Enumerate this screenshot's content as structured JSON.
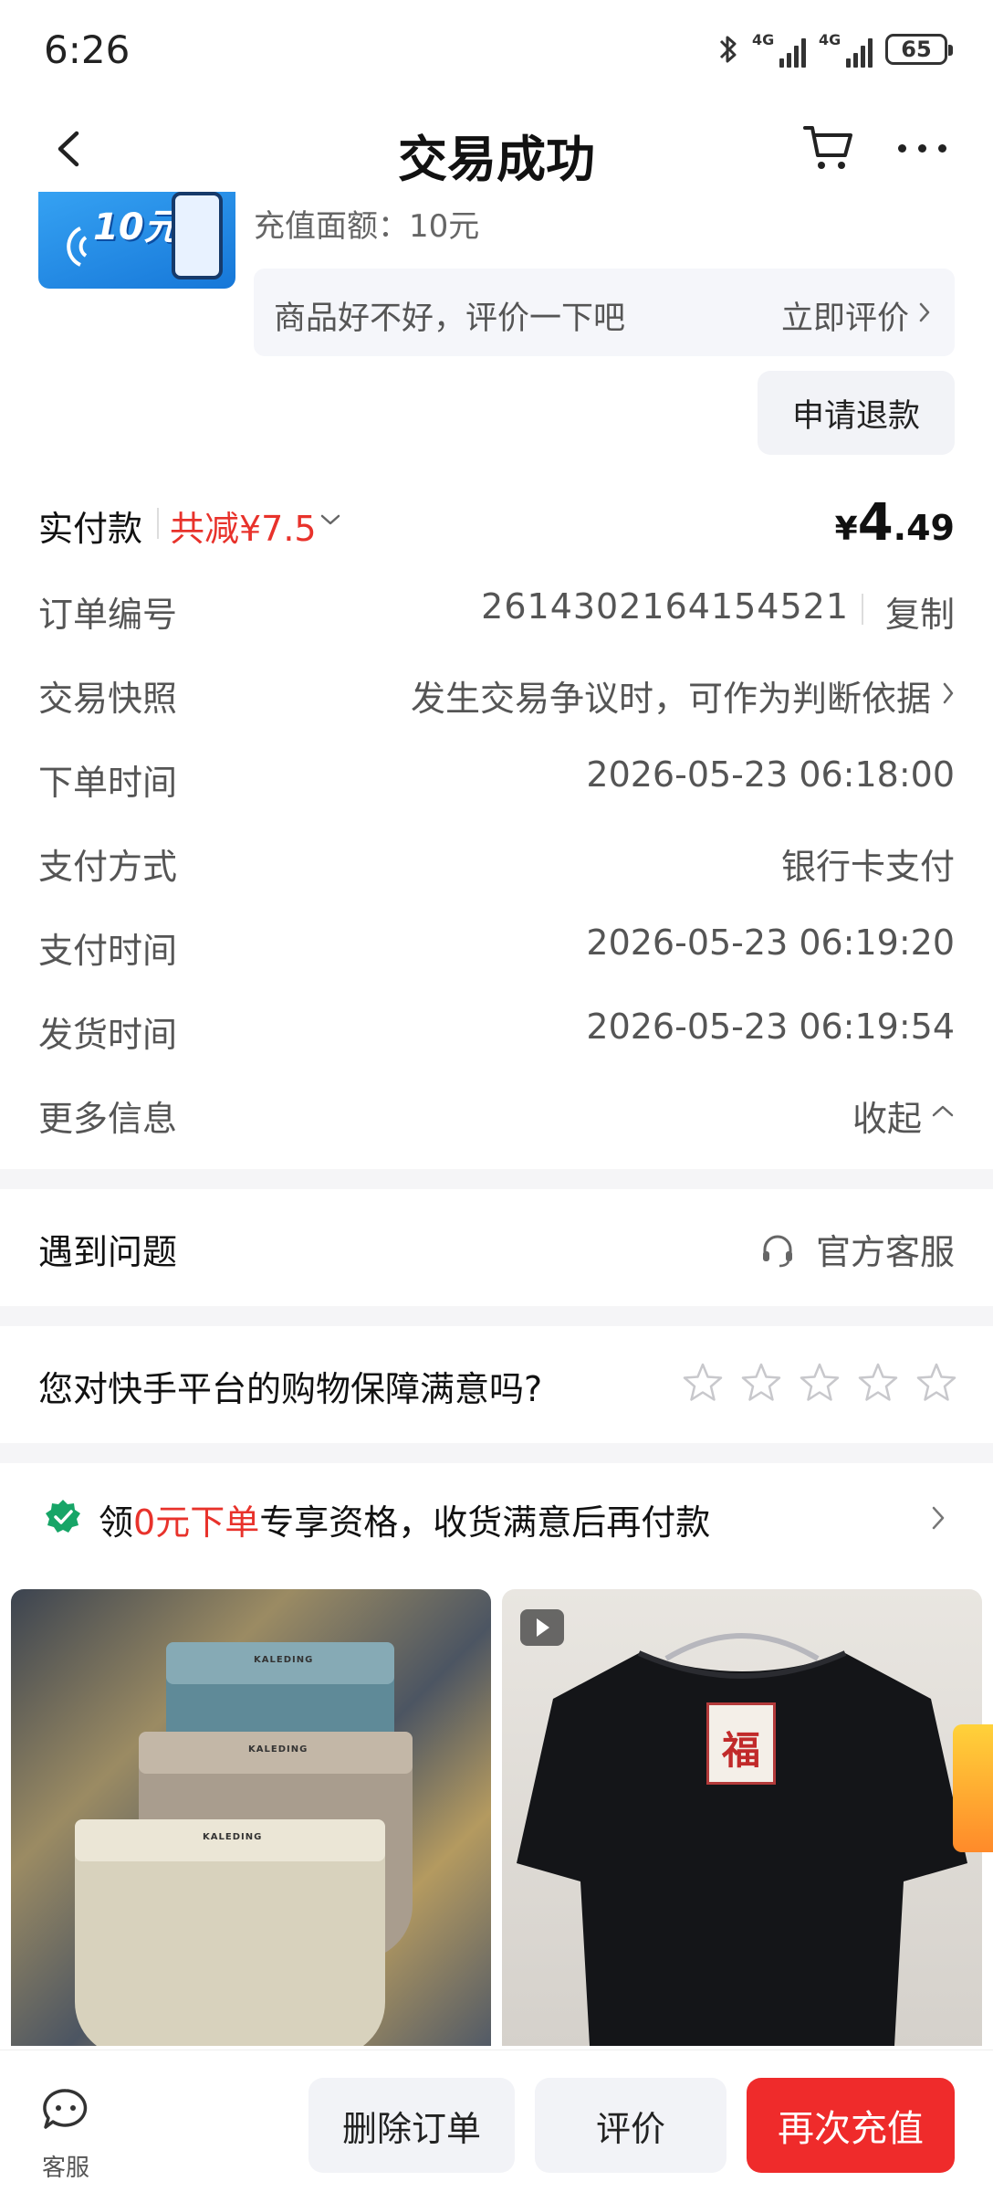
{
  "status_bar": {
    "time": "6:26",
    "signal1_label": "4G",
    "signal2_label": "4G",
    "battery": "65"
  },
  "nav": {
    "title": "交易成功"
  },
  "product": {
    "thumb_text": "10元",
    "spec": "充值面额：10元",
    "review_prompt": "商品好不好，评价一下吧",
    "review_action": "立即评价",
    "refund_label": "申请退款"
  },
  "payment": {
    "label": "实付款",
    "discount": "共减¥7.5",
    "currency": "¥",
    "amount_int": "4",
    "amount_dec": ".49"
  },
  "order_info": {
    "order_no_label": "订单编号",
    "order_no": "2614302164154521",
    "copy_label": "复制",
    "snapshot_label": "交易快照",
    "snapshot_value": "发生交易争议时，可作为判断依据",
    "order_time_label": "下单时间",
    "order_time": "2026-05-23 06:18:00",
    "pay_method_label": "支付方式",
    "pay_method": "银行卡支付",
    "pay_time_label": "支付时间",
    "pay_time": "2026-05-23 06:19:20",
    "ship_time_label": "发货时间",
    "ship_time": "2026-05-23 06:19:54",
    "more_label": "更多信息",
    "collapse_label": "收起"
  },
  "problem": {
    "title": "遇到问题",
    "service": "官方客服"
  },
  "survey": {
    "question": "您对快手平台的购物保障满意吗?",
    "rating": 0,
    "max_rating": 5
  },
  "promo": {
    "prefix": "领",
    "highlight": "0元下单",
    "suffix": "专享资格，收货满意后再付款"
  },
  "recommend": {
    "card1_brand": "KALEDING",
    "card2_patch": "福"
  },
  "bottom_bar": {
    "service_label": "客服",
    "delete_label": "删除订单",
    "review_label": "评价",
    "again_label": "再次充值"
  },
  "colors": {
    "accent_red": "#ef2b2b",
    "discount_red": "#e8322b",
    "promo_green": "#17a567"
  }
}
